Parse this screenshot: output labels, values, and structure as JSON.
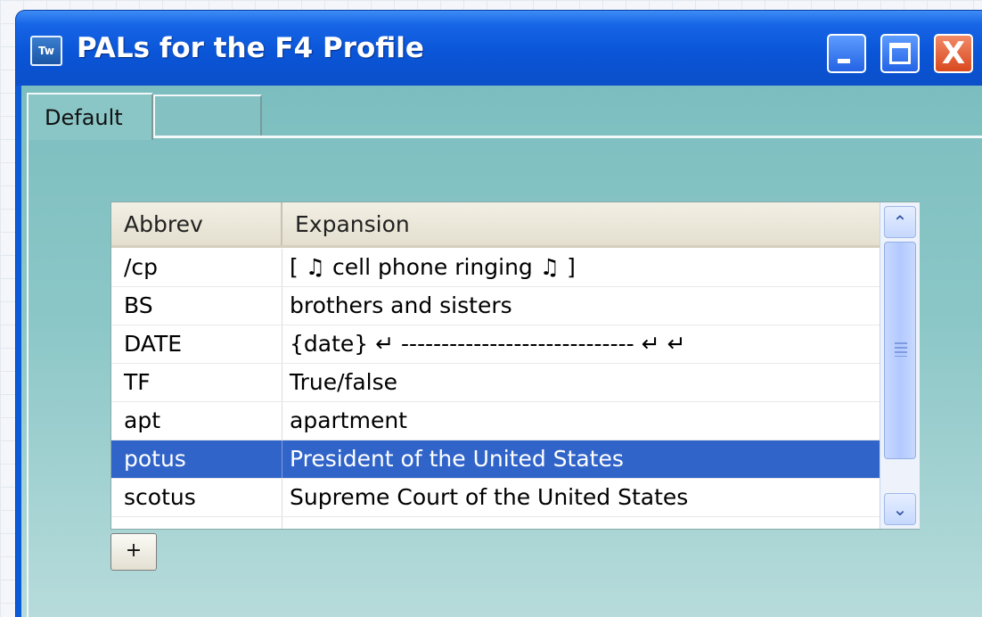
{
  "window": {
    "title": "PALs for the F4 Profile",
    "icon_label": "Tw",
    "icon": "app-icon",
    "controls": {
      "minimize_icon": "minimize-icon",
      "maximize_icon": "maximize-icon",
      "close_icon": "close-icon",
      "close_glyph": "X"
    }
  },
  "tabs": [
    {
      "label": "Default",
      "active": true
    },
    {
      "label": "",
      "active": false
    }
  ],
  "grid": {
    "columns": [
      "Abbrev",
      "Expansion"
    ],
    "rows": [
      {
        "abbrev": "/cp",
        "expansion": "[ ♫ cell phone ringing ♫ ]"
      },
      {
        "abbrev": "BS",
        "expansion": "brothers and sisters"
      },
      {
        "abbrev": "DATE",
        "expansion": "{date} ↵  ----------------------------- ↵  ↵"
      },
      {
        "abbrev": "TF",
        "expansion": "True/false"
      },
      {
        "abbrev": "apt",
        "expansion": "apartment"
      },
      {
        "abbrev": "potus",
        "expansion": "President of the United States",
        "selected": true
      },
      {
        "abbrev": "scotus",
        "expansion": "Supreme Court of the United States"
      },
      {
        "abbrev": "",
        "expansion": ""
      }
    ],
    "selection_color": "#3164c9"
  },
  "scrollbar": {
    "up_glyph": "⌃",
    "down_glyph": "⌄"
  },
  "add_button": {
    "label": "+"
  },
  "colors": {
    "titlebar": "#0a55d8",
    "client": "#8cc7c7",
    "close": "#d9491f"
  }
}
